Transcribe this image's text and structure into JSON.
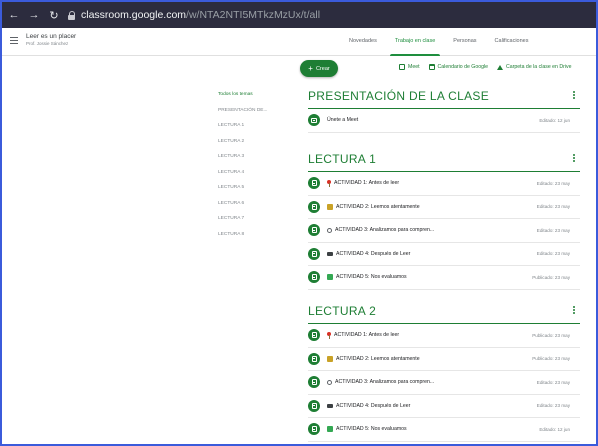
{
  "browser": {
    "url_host": "classroom.google.com",
    "url_path": "/w/NTA2NTI5MTkzMzUx/t/all"
  },
  "course": {
    "title": "Leer es un placer",
    "teacher": "Prof. Jossie Sánchez"
  },
  "tabs": [
    {
      "label": "Novedades",
      "active": false
    },
    {
      "label": "Trabajo en clase",
      "active": true
    },
    {
      "label": "Personas",
      "active": false
    },
    {
      "label": "Calificaciones",
      "active": false
    }
  ],
  "actions": {
    "create_label": "Crear",
    "meet_label": "Meet",
    "calendar_label": "Calendario de Google",
    "drive_label": "Carpeta de la clase en Drive"
  },
  "topics": [
    {
      "label": "Todos los temas",
      "active": true
    },
    {
      "label": "PRESENTACIÓN DE...",
      "active": false
    },
    {
      "label": "LECTURA 1",
      "active": false
    },
    {
      "label": "LECTURA 2",
      "active": false
    },
    {
      "label": "LECTURA 3",
      "active": false
    },
    {
      "label": "LECTURA 4",
      "active": false
    },
    {
      "label": "LECTURA 5",
      "active": false
    },
    {
      "label": "LECTURA 6",
      "active": false
    },
    {
      "label": "LECTURA 7",
      "active": false
    },
    {
      "label": "LECTURA 8",
      "active": false
    }
  ],
  "sections": [
    {
      "title": "PRESENTACIÓN DE LA CLASE",
      "items": [
        {
          "label": "Únete a Meet",
          "date": "Editado: 12 jun",
          "emoji": "",
          "icon": "meet-icon"
        }
      ]
    },
    {
      "title": "LECTURA 1",
      "items": [
        {
          "label": "ACTIVIDAD 1: Antes de leer",
          "date": "Editado: 23 may",
          "emoji": "pin",
          "icon": "assignment-icon"
        },
        {
          "label": "ACTIVIDAD 2: Leemos atentamente",
          "date": "Editado: 23 may",
          "emoji": "book",
          "icon": "assignment-icon"
        },
        {
          "label": "ACTIVIDAD 3: Analizamos para compren...",
          "date": "Editado: 23 may",
          "emoji": "search",
          "icon": "assignment-icon"
        },
        {
          "label": "ACTIVIDAD 4: Después de Leer",
          "date": "Editado: 23 may",
          "emoji": "pc",
          "icon": "material-icon"
        },
        {
          "label": "ACTIVIDAD 5: Nos evaluamos",
          "date": "Publicado: 23 may",
          "emoji": "check",
          "icon": "quiz-icon"
        }
      ]
    },
    {
      "title": "LECTURA 2",
      "items": [
        {
          "label": "ACTIVIDAD 1: Antes de leer",
          "date": "Publicado: 23 may",
          "emoji": "pin",
          "icon": "assignment-icon"
        },
        {
          "label": "ACTIVIDAD 2: Leemos atentamente",
          "date": "Publicado: 23 may",
          "emoji": "book",
          "icon": "assignment-icon"
        },
        {
          "label": "ACTIVIDAD 3: Analizamos para compren...",
          "date": "Editado: 23 may",
          "emoji": "search",
          "icon": "assignment-icon"
        },
        {
          "label": "ACTIVIDAD 4: Después de Leer",
          "date": "Editado: 23 may",
          "emoji": "pc",
          "icon": "material-icon"
        },
        {
          "label": "ACTIVIDAD 5: Nos evaluamos",
          "date": "Editado: 12 jun",
          "emoji": "check",
          "icon": "quiz-icon"
        }
      ]
    }
  ],
  "colors": {
    "accent": "#1e7e34",
    "browser_bar": "#2c2c3e",
    "frame": "#3b5bdb"
  }
}
